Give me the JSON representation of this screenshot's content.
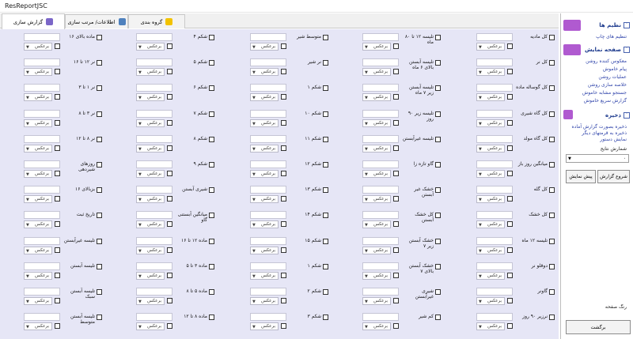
{
  "window": {
    "title": "ResReportJSC"
  },
  "tabs": [
    {
      "label": "گزارش سازی",
      "icon": "report-icon",
      "active": true
    },
    {
      "label": "اطلاعات/ مرتب سازی",
      "icon": "database-icon",
      "active": false
    },
    {
      "label": "گروه بندی",
      "icon": "group-icon",
      "active": false
    }
  ],
  "combo_text": "برعکس",
  "field_columns": [
    {
      "rows": [
        "کل مادیه",
        "کل نر",
        "کل گوساله ماده",
        "کل گاه شیری",
        "کل گاه مولد",
        "میانگین روز باز",
        "کل گله",
        "کل خشک",
        "تلیسه ۱۲ ماه",
        "دوقلو نر",
        "گاونر",
        "نرزیر ۹۰ روز"
      ]
    },
    {
      "rows": [
        "تلیسه ۱۲ تا ۸۰ ماه",
        "تلیسه آبستن بالای ۶ ماه",
        "تلیسه آبستن زیر ۷ ماه",
        "تلیسه زیر ۹۰ روز",
        "تلیسه غیرآبستن",
        "گاو تازه زا",
        "خشک غیر آبستن",
        "کل خشک آبستن",
        "خشک آبستن زیر ۷",
        "خشک آبستن بالای ۷",
        "شیری غیرآبستن",
        "کم شیر"
      ]
    },
    {
      "rows": [
        "متوسط شیر",
        "نر شیر",
        "شکم ۱",
        "شکم ۱۰",
        "شکم ۱۱",
        "شکم ۱۲",
        "شکم ۱۳",
        "شکم ۱۴",
        "شکم ۱۵",
        "شکم ۱",
        "شکم ۲",
        "شکم ۳"
      ]
    },
    {
      "rows": [
        "شکم ۴",
        "شکم ۵",
        "شکم ۶",
        "شکم ۷",
        "شکم ۸",
        "شکم ۹",
        "شیری آبستن",
        "میانگین آبستنی گاو",
        "ماده ۱۲ تا ۱۶",
        "ماده ۳ تا ۵",
        "ماده ۵ تا ۸",
        "ماده ۸ تا ۱۲"
      ]
    },
    {
      "rows": [
        "ماده بالای ۱۶",
        "نر ۱۲ تا ۱۶",
        "نر ۱ تا ۳",
        "نر ۳ تا ۸",
        "نر ۸ تا ۱۲",
        "روزهای شیردهی",
        "بزبالای ۱۶",
        "تاریخ ثبت",
        "تلیسه غیرآبستن",
        "تلیسه آبستن",
        "تلیسه آبستن سبک",
        "تلیسه آبستن متوسط"
      ]
    }
  ],
  "sidebar": {
    "sections": [
      {
        "title": "نظیم ها",
        "links": [
          "تنظیم های چاپ"
        ]
      },
      {
        "title": "صفحه نمایش",
        "links": [
          "معکوس کننده روشن",
          "پیام خاموش",
          "عملیات روشن",
          "خلاصه سازی روشن",
          "جستجو مشابه خاموش",
          "گزارش سریع خاموش"
        ]
      },
      {
        "title": "ذخیره",
        "links": [
          "ذخیره بصورت گزارش آماده",
          "ذخیره به قرمتهای دیگر",
          "نمایش دستور"
        ]
      }
    ],
    "counter_label": "شمارش نتایج",
    "counter_value": "۰",
    "start_button": "شروع گزارش",
    "preview_button": "پیش نمایش",
    "page_color_label": "رنگ صفحه",
    "back_button": "برگشت"
  },
  "colors": {
    "panel_bg": "#e6e6f6",
    "link": "#2a3fa8",
    "header": "#1f3c8e",
    "accent_icon": "#b05ad0"
  }
}
